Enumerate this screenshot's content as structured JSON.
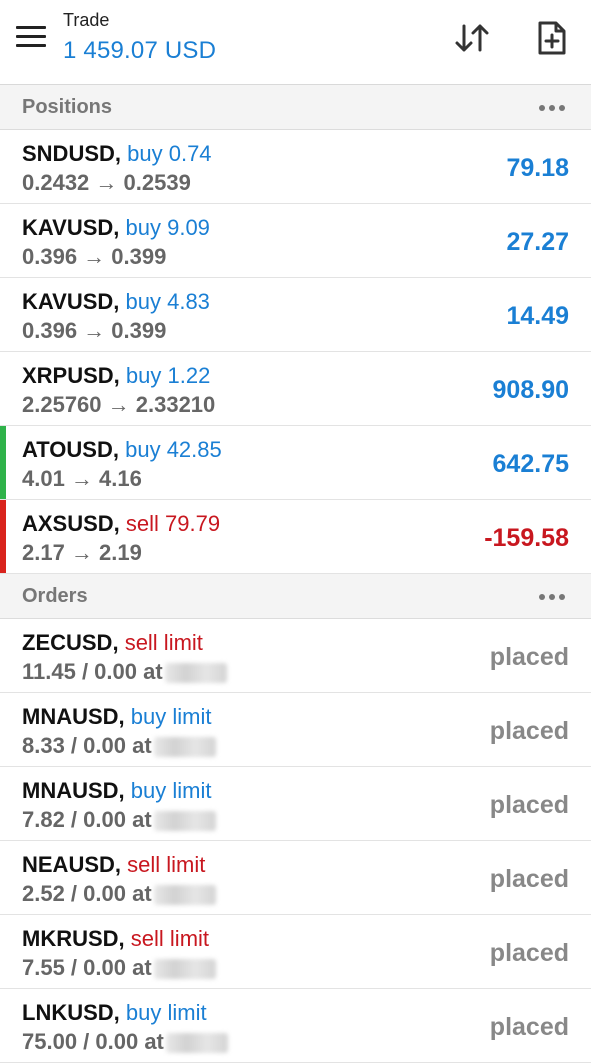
{
  "header": {
    "title": "Trade",
    "balance": "1 459.07 USD",
    "icons": [
      "menu-icon",
      "sort-icon",
      "new-order-icon"
    ]
  },
  "positions": {
    "title": "Positions",
    "items": [
      {
        "symbol": "SNDUSD,",
        "dir": "buy 0.74",
        "side": "buy",
        "prices": "0.2432 → 0.2539",
        "profit": "79.18",
        "accent": ""
      },
      {
        "symbol": "KAVUSD,",
        "dir": "buy 9.09",
        "side": "buy",
        "prices": "0.396 → 0.399",
        "profit": "27.27",
        "accent": ""
      },
      {
        "symbol": "KAVUSD,",
        "dir": "buy 4.83",
        "side": "buy",
        "prices": "0.396 → 0.399",
        "profit": "14.49",
        "accent": ""
      },
      {
        "symbol": "XRPUSD,",
        "dir": "buy 1.22",
        "side": "buy",
        "prices": "2.25760 → 2.33210",
        "profit": "908.90",
        "accent": ""
      },
      {
        "symbol": "ATOUSD,",
        "dir": "buy 42.85",
        "side": "buy",
        "prices": "4.01 → 4.16",
        "profit": "642.75",
        "accent": "#2fb24a"
      },
      {
        "symbol": "AXSUSD,",
        "dir": "sell 79.79",
        "side": "sell",
        "prices": "2.17 → 2.19",
        "profit": "-159.58",
        "accent": "#d9231d"
      }
    ]
  },
  "orders": {
    "title": "Orders",
    "items": [
      {
        "symbol": "ZECUSD,",
        "dir": "sell limit",
        "side": "sell",
        "volume": "11.45 / 0.00 at",
        "state": "placed"
      },
      {
        "symbol": "MNAUSD,",
        "dir": "buy limit",
        "side": "buy",
        "volume": "8.33 / 0.00 at",
        "state": "placed"
      },
      {
        "symbol": "MNAUSD,",
        "dir": "buy limit",
        "side": "buy",
        "volume": "7.82 / 0.00 at",
        "state": "placed"
      },
      {
        "symbol": "NEAUSD,",
        "dir": "sell limit",
        "side": "sell",
        "volume": "2.52 / 0.00 at",
        "state": "placed"
      },
      {
        "symbol": "MKRUSD,",
        "dir": "sell limit",
        "side": "sell",
        "volume": "7.55 / 0.00 at",
        "state": "placed"
      },
      {
        "symbol": "LNKUSD,",
        "dir": "buy limit",
        "side": "buy",
        "volume": "75.00 / 0.00 at",
        "state": "placed"
      }
    ]
  },
  "colors": {
    "accent_blue": "#1a7fd4",
    "loss_red": "#c8171f",
    "buy_marker_green": "#2fb24a",
    "sell_marker_red": "#d9231d"
  }
}
